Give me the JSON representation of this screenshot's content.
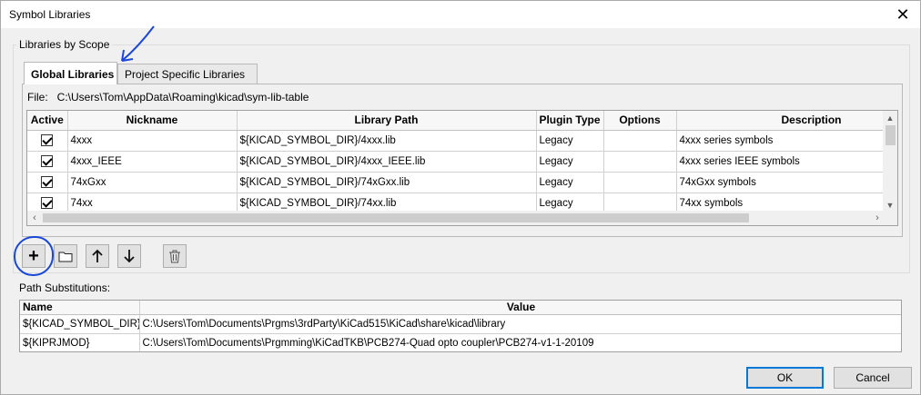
{
  "window": {
    "title": "Symbol Libraries"
  },
  "scope": {
    "group_label": "Libraries by Scope",
    "tabs": [
      {
        "label": "Global Libraries",
        "active": true
      },
      {
        "label": "Project Specific Libraries",
        "active": false
      }
    ],
    "file_label": "File:",
    "file_path": "C:\\Users\\Tom\\AppData\\Roaming\\kicad\\sym-lib-table",
    "columns": [
      "Active",
      "Nickname",
      "Library Path",
      "Plugin Type",
      "Options",
      "Description"
    ],
    "rows": [
      {
        "active": true,
        "nickname": "4xxx",
        "path": "${KICAD_SYMBOL_DIR}/4xxx.lib",
        "plugin": "Legacy",
        "options": "",
        "description": "4xxx series symbols"
      },
      {
        "active": true,
        "nickname": "4xxx_IEEE",
        "path": "${KICAD_SYMBOL_DIR}/4xxx_IEEE.lib",
        "plugin": "Legacy",
        "options": "",
        "description": "4xxx series IEEE symbols"
      },
      {
        "active": true,
        "nickname": "74xGxx",
        "path": "${KICAD_SYMBOL_DIR}/74xGxx.lib",
        "plugin": "Legacy",
        "options": "",
        "description": "74xGxx symbols"
      },
      {
        "active": true,
        "nickname": "74xx",
        "path": "${KICAD_SYMBOL_DIR}/74xx.lib",
        "plugin": "Legacy",
        "options": "",
        "description": "74xx symbols"
      }
    ]
  },
  "toolbar": {
    "add_icon": "plus-icon",
    "browse_icon": "folder-icon",
    "up_icon": "arrow-up-icon",
    "down_icon": "arrow-down-icon",
    "delete_icon": "trash-icon"
  },
  "substitutions": {
    "label": "Path Substitutions:",
    "columns": [
      "Name",
      "Value"
    ],
    "rows": [
      {
        "name": "${KICAD_SYMBOL_DIR}",
        "value": "C:\\Users\\Tom\\Documents\\Prgms\\3rdParty\\KiCad515\\KiCad\\share\\kicad\\library"
      },
      {
        "name": "${KIPRJMOD}",
        "value": "C:\\Users\\Tom\\Documents\\Prgmming\\KiCadTKB\\PCB274-Quad opto coupler\\PCB274-v1-1-20109"
      }
    ]
  },
  "buttons": {
    "ok": "OK",
    "cancel": "Cancel"
  },
  "colors": {
    "annotation": "#1b47d8",
    "default_button_border": "#0078d7"
  }
}
